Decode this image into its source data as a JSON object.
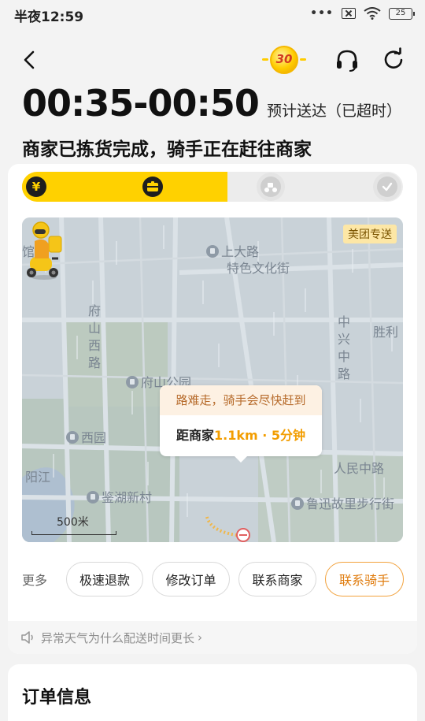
{
  "status_bar": {
    "time": "半夜12:59",
    "signal_dots": "•••",
    "battery": "25"
  },
  "topbar": {
    "medal_number": "30"
  },
  "eta": {
    "time_range": "00:35-00:50",
    "label": "预计送达（已超时）"
  },
  "status_title": "商家已拣货完成，骑手正在赶往商家",
  "progress": {
    "completed_fraction": 0.54,
    "steps": [
      {
        "icon": "yen-icon",
        "glyph": "¥",
        "state": "done"
      },
      {
        "icon": "package-icon",
        "glyph": "▬",
        "state": "done"
      },
      {
        "icon": "scooter-icon",
        "glyph": "",
        "state": "pending"
      },
      {
        "icon": "check-icon",
        "glyph": "",
        "state": "pending"
      }
    ]
  },
  "map": {
    "tag": "美团专送",
    "labels": {
      "shangda_road": "上大路",
      "culture_street": "特色文化街",
      "fushan_west_road": "府山西路",
      "fushan_park": "府山公园",
      "zhongxing_road": "中兴中路",
      "shengli": "胜利",
      "xiyuan": "西园",
      "jianhu": "鉴湖新村",
      "renmin_road": "人民中路",
      "luxun": "鲁迅故里步行街",
      "guan": "馆",
      "yang": "阳江"
    },
    "bubble": {
      "notice": "路难走，骑手会尽快赶到",
      "distance_prefix": "距商家",
      "distance_value": "1.1km · 5分钟"
    },
    "scale": "500米"
  },
  "actions": {
    "more_label": "更多",
    "buttons": [
      "极速退款",
      "修改订单",
      "联系商家",
      "联系骑手"
    ]
  },
  "tip": {
    "text": "异常天气为什么配送时间更长",
    "arrow": "›"
  },
  "order_section": {
    "title": "订单信息"
  },
  "colors": {
    "brand_yellow": "#ffd100",
    "accent_orange": "#e07d10"
  }
}
